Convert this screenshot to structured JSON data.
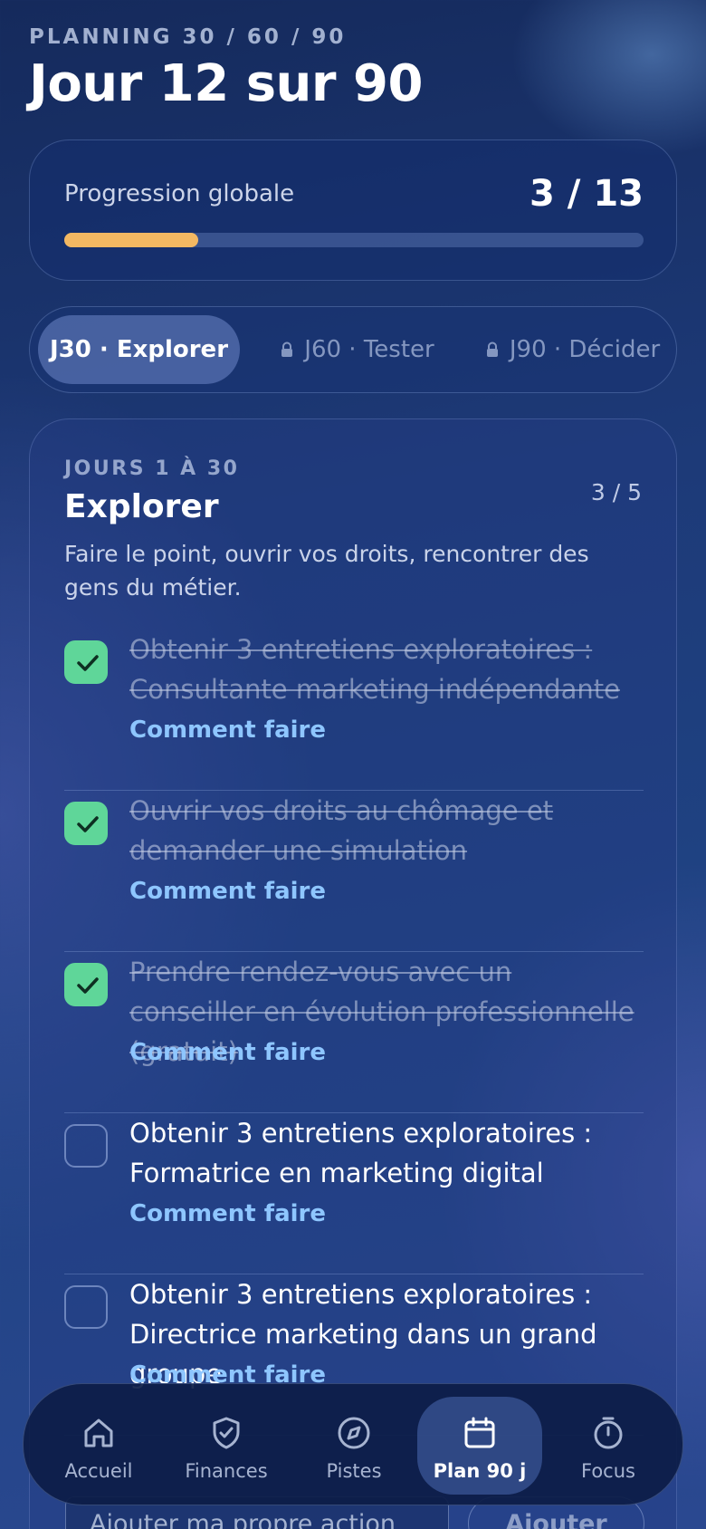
{
  "header": {
    "eyebrow": "PLANNING 30 / 60 / 90",
    "title": "Jour 12 sur 90"
  },
  "progress": {
    "label": "Progression globale",
    "count": "3 / 13",
    "fraction": 0.2308,
    "fill_color": "#f3b862"
  },
  "tabs": [
    {
      "label": "J30 · Explorer",
      "active": true,
      "locked": false
    },
    {
      "label": "J60 · Tester",
      "active": false,
      "locked": true
    },
    {
      "label": "J90 · Décider",
      "active": false,
      "locked": true
    }
  ],
  "phase": {
    "eyebrow": "JOURS 1 À 30",
    "title": "Explorer",
    "count": "3 / 5",
    "description": "Faire le point, ouvrir vos droits, rencontrer des gens du métier."
  },
  "tasks": [
    {
      "text": "Obtenir 3 entretiens exploratoires : Consultante marketing indépendante",
      "done": true,
      "howto": "Comment faire"
    },
    {
      "text": "Ouvrir vos droits au chômage et demander une simulation",
      "done": true,
      "howto": "Comment faire"
    },
    {
      "text": "Prendre rendez-vous avec un conseiller en évolution professionnelle (gratuit)",
      "done": true,
      "howto": "Comment faire"
    },
    {
      "text": "Obtenir 3 entretiens exploratoires : Formatrice en marketing digital",
      "done": false,
      "howto": "Comment faire"
    },
    {
      "text": "Obtenir 3 entretiens exploratoires : Directrice marketing dans un grand groupe",
      "done": false,
      "howto": "Comment faire"
    }
  ],
  "add_action": {
    "placeholder": "Ajouter ma propre action",
    "button": "Ajouter"
  },
  "nav": [
    {
      "label": "Accueil",
      "icon": "home-icon",
      "active": false
    },
    {
      "label": "Finances",
      "icon": "shield-check-icon",
      "active": false
    },
    {
      "label": "Pistes",
      "icon": "compass-icon",
      "active": false
    },
    {
      "label": "Plan 90 j",
      "icon": "calendar-icon",
      "active": true
    },
    {
      "label": "Focus",
      "icon": "timer-icon",
      "active": false
    }
  ],
  "colors": {
    "check_green": "#5fd699",
    "link_blue": "#8ec6ff",
    "accent_orange": "#f3b862"
  }
}
